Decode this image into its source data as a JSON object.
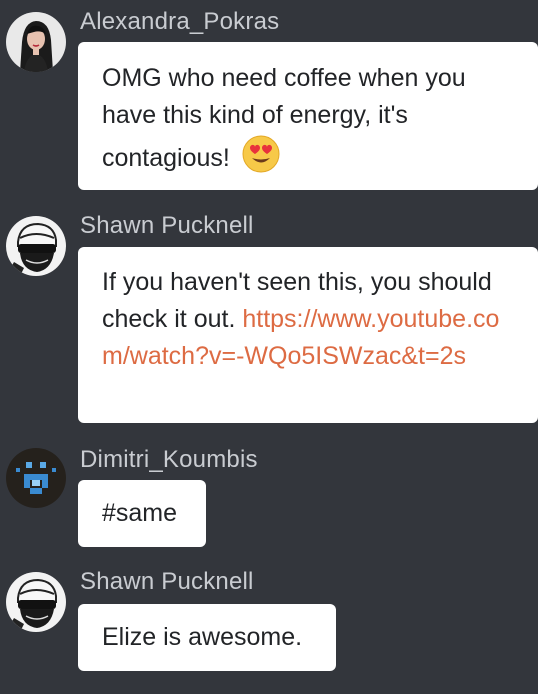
{
  "colors": {
    "background": "#33363c",
    "username": "#c9ccd1",
    "bubble": "#ffffff",
    "message_text": "#222427",
    "link": "#dd6b43"
  },
  "messages": [
    {
      "username": "Alexandra_Pokras",
      "avatar_icon": "profile-photo-woman",
      "text": "OMG who need coffee when you have this kind of energy, it's contagious!",
      "emoji": "heart-eyes-emoji"
    },
    {
      "username": "Shawn Pucknell",
      "avatar_icon": "masked-face-avatar",
      "text": "If you haven't seen this, you should check it out.",
      "link": "https://www.youtube.com/watch?v=-WQo5ISWzac&t=2s"
    },
    {
      "username": "Dimitri_Koumbis",
      "avatar_icon": "pixel-face-avatar",
      "text": "#same"
    },
    {
      "username": "Shawn Pucknell",
      "avatar_icon": "masked-face-avatar",
      "text": "Elize is awesome."
    }
  ]
}
